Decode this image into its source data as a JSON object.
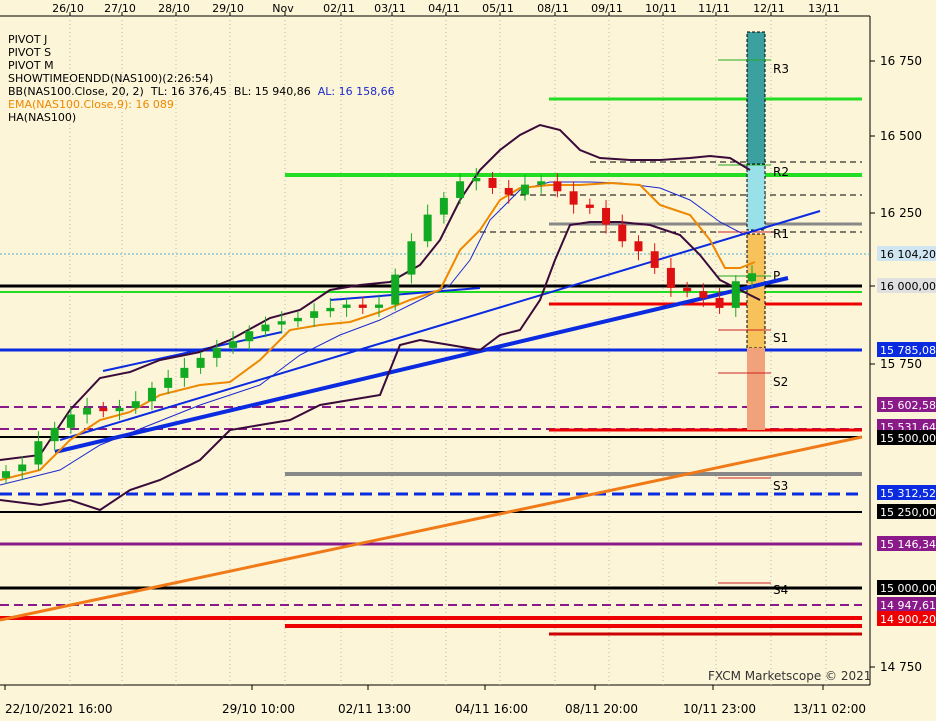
{
  "top_dates": [
    "26/10",
    "27/10",
    "28/10",
    "29/10",
    "Nov",
    "02/11",
    "03/11",
    "04/11",
    "05/11",
    "08/11",
    "09/11",
    "10/11",
    "11/11",
    "12/11",
    "13/11"
  ],
  "bottom_dates": [
    "22/10/2021 16:00",
    "29/10 10:00",
    "02/11 13:00",
    "04/11 16:00",
    "08/11 20:00",
    "10/11 23:00",
    "13/11 02:00"
  ],
  "indicators": {
    "pivot_j": "PIVOT J",
    "pivot_s": "PIVOT S",
    "pivot_m": "PIVOT M",
    "showtime": "SHOWTIMEOENDD(NAS100)(2:26:54)",
    "bb_name": "BB(NAS100.Close, 20, 2)",
    "bb_tl": "TL: 16 376,45",
    "bb_bl": "BL: 15 940,86",
    "bb_al": "AL: 16 158,66",
    "ema": "EMA(NAS100.Close,9): 16 089",
    "ha": "HA(NAS100)"
  },
  "watermark": "FXCM Marketscope © 2021",
  "colors": {
    "background": "#fdf5d8",
    "axis_bg": "#fdf5d8",
    "green_line": "#22dd22",
    "red_line": "#ee0000",
    "blue_line": "#0a2be0",
    "purple_line": "#8a1a8a",
    "orange_line": "#f07a18",
    "gray_line": "#888888",
    "bull_candle": "#11aa22",
    "bear_candle": "#dd1111",
    "bb_band": "#3a0a3a",
    "bb_mid": "#1a2ad0",
    "ema": "#ee8800",
    "pivot_column_top": "#3aa0a0",
    "pivot_column_mid": "#9ae0e8",
    "pivot_column_low": "#f7c25a",
    "pivot_column_bottom": "#f2a27a"
  },
  "chart_data": {
    "type": "candlestick",
    "title": "",
    "symbol": "NAS100",
    "y_axis_ticks": [
      "16 750",
      "16 500",
      "16 250",
      "16 000",
      "15 750",
      "14 750"
    ],
    "ylim": [
      14700,
      16900
    ],
    "grid": "vertical dotted",
    "price_tags": [
      {
        "label": "16 104,20",
        "bg": "#cfe6f2"
      },
      {
        "label": "16 000,00",
        "bg": "#e0e0e0"
      },
      {
        "label": "15 785,08",
        "bg": "#0a2be0"
      },
      {
        "label": "15 602,58",
        "bg": "#8a1a8a"
      },
      {
        "label": "15 531,64",
        "bg": "#8a1a8a"
      },
      {
        "label": "15 500,00",
        "bg": "#000000"
      },
      {
        "label": "15 312,52",
        "bg": "#0a2be0"
      },
      {
        "label": "15 250,00",
        "bg": "#000000"
      },
      {
        "label": "15 146,34",
        "bg": "#8a1a8a"
      },
      {
        "label": "15 000,00",
        "bg": "#000000"
      },
      {
        "label": "14 947,61",
        "bg": "#8a1a8a"
      },
      {
        "label": "14 900,20",
        "bg": "#ee0000"
      }
    ],
    "pivot_labels": [
      "R3",
      "R2",
      "R1",
      "P",
      "S1",
      "S2",
      "S3",
      "S4"
    ],
    "bollinger": {
      "period": 20,
      "deviation": 2,
      "top": 16376.45,
      "bottom": 15940.86,
      "average": 16158.66
    },
    "ema": {
      "period": 9,
      "value": 16089
    },
    "approx_closes": [
      15510,
      15530,
      15600,
      15640,
      15680,
      15700,
      15690,
      15700,
      15720,
      15760,
      15790,
      15820,
      15850,
      15880,
      15900,
      15930,
      15950,
      15960,
      15970,
      15990,
      16000,
      16010,
      16000,
      16010,
      16100,
      16200,
      16280,
      16330,
      16380,
      16390,
      16360,
      16340,
      16370,
      16380,
      16350,
      16310,
      16300,
      16250,
      16200,
      16170,
      16120,
      16060,
      16050,
      16030,
      16000,
      16080,
      16104
    ]
  }
}
